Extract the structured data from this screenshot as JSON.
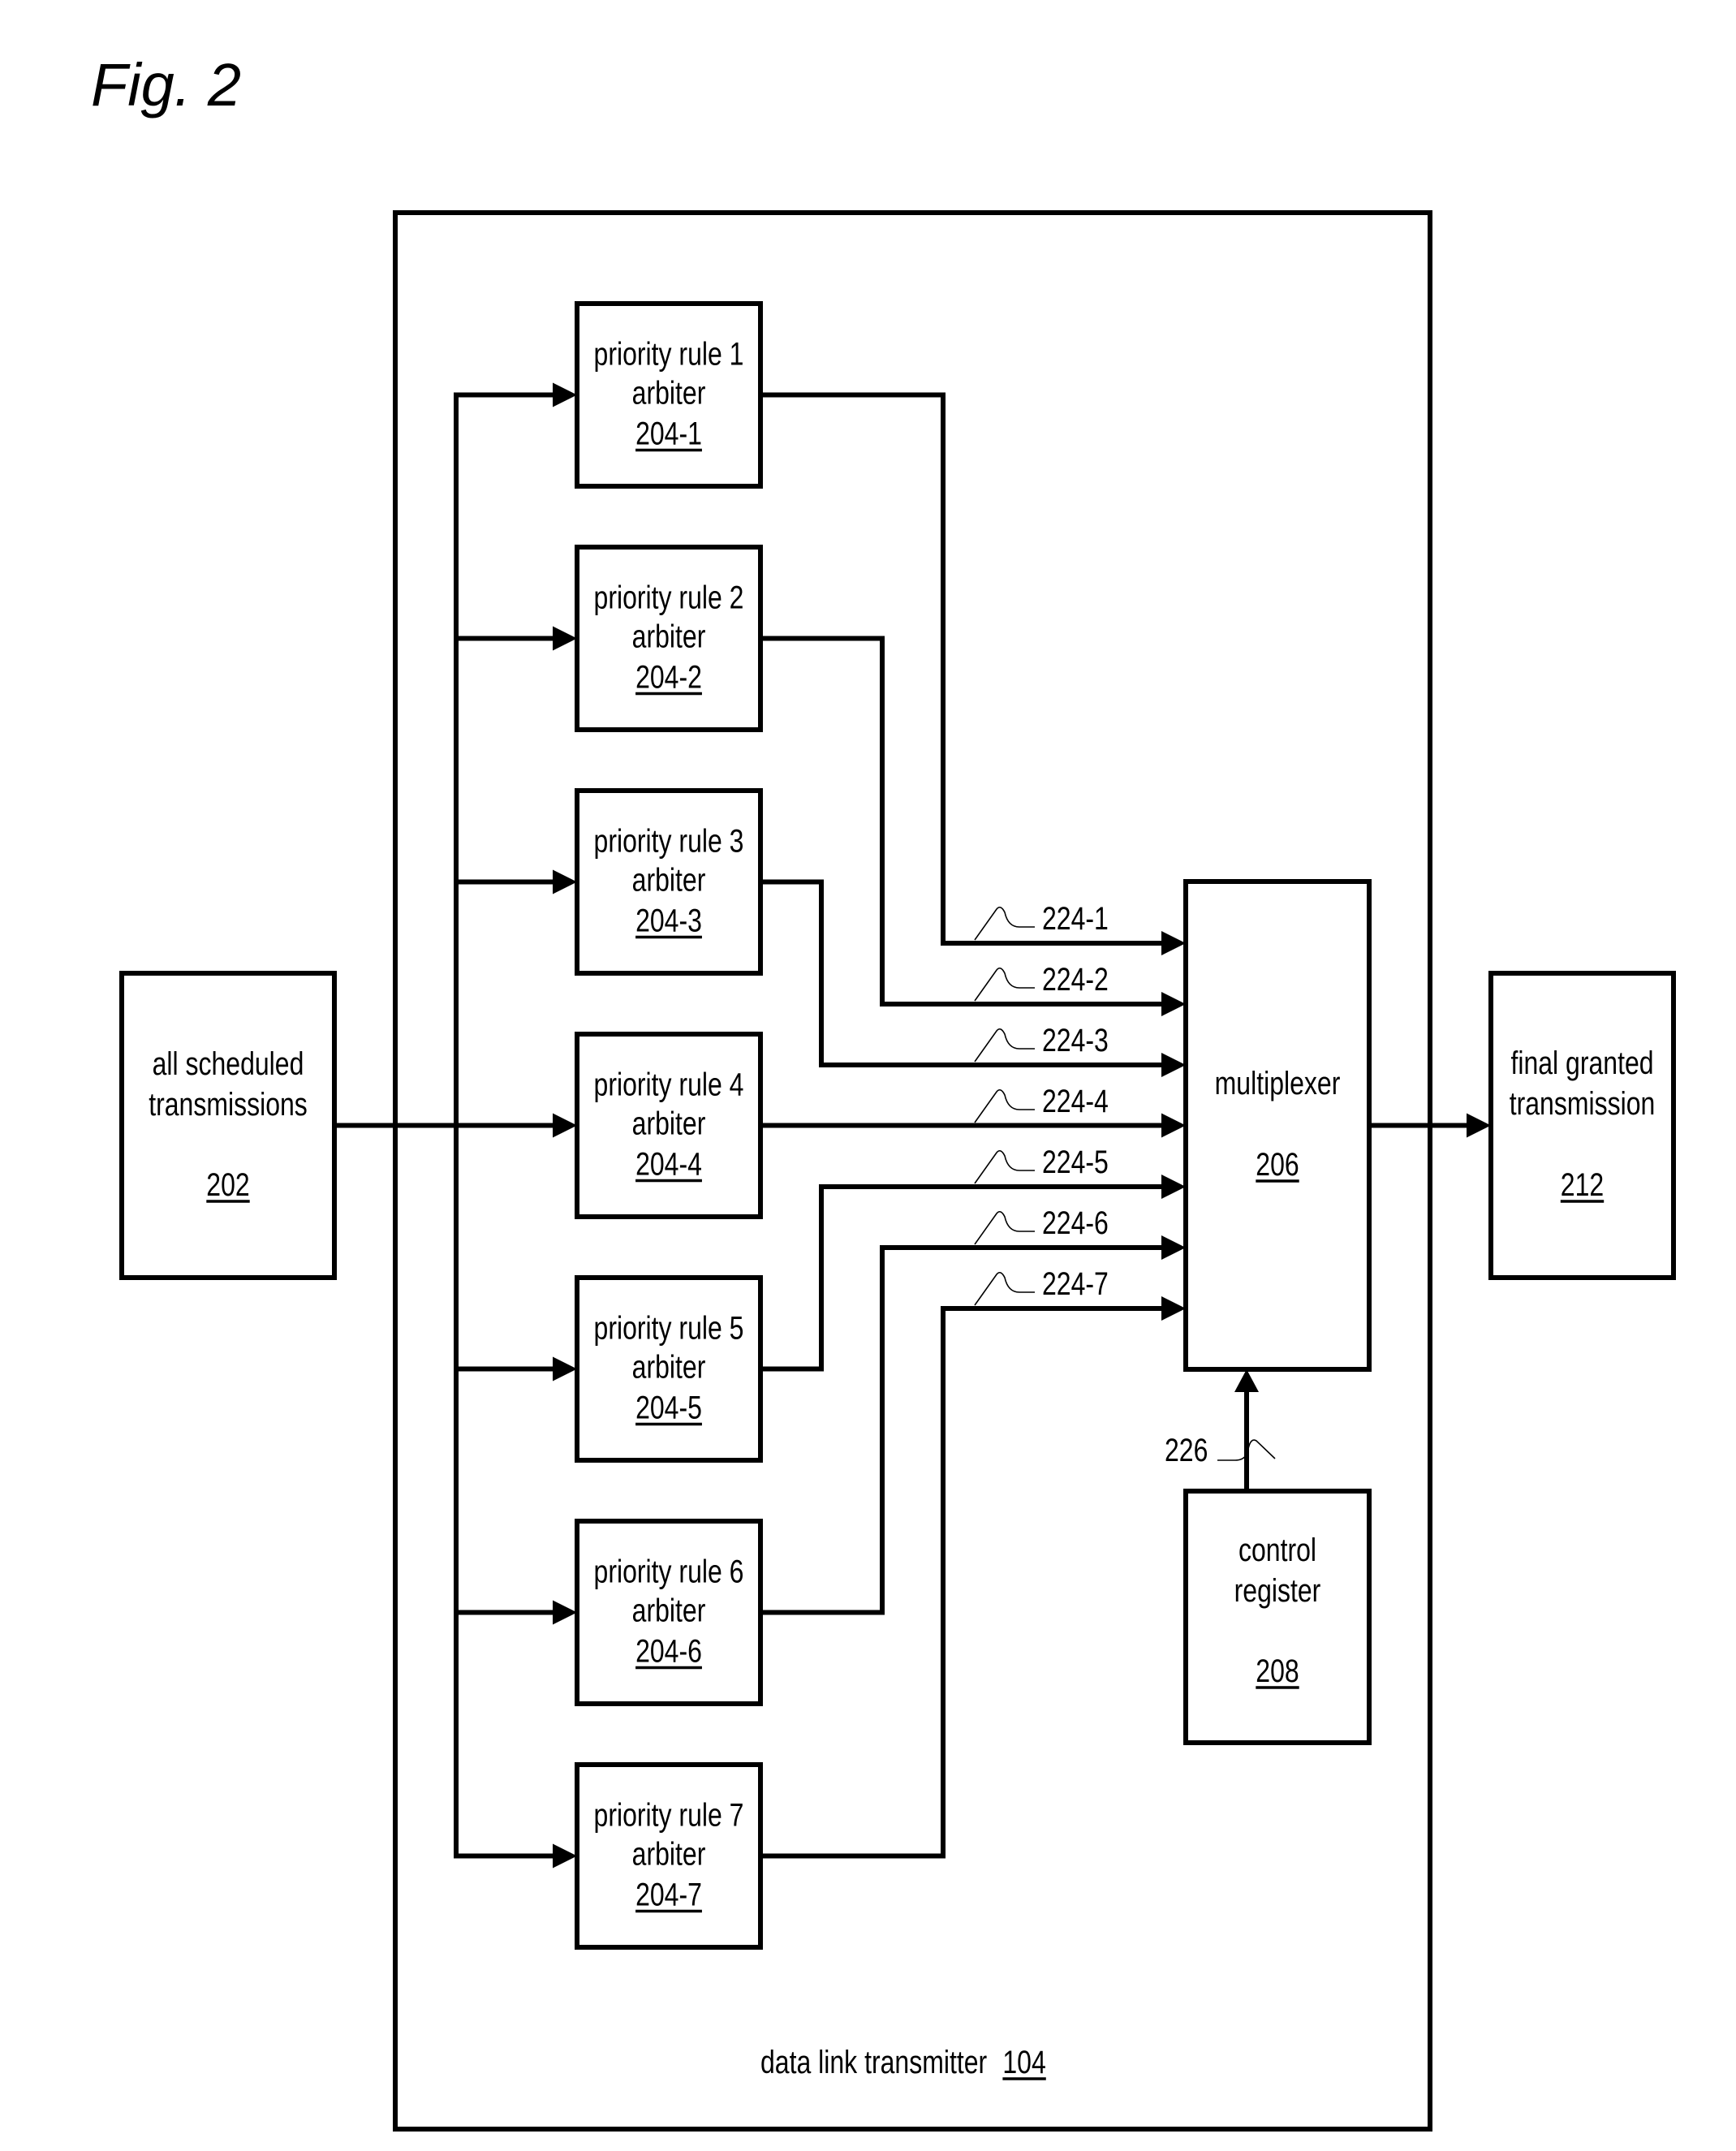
{
  "figure": {
    "title": "Fig. 2"
  },
  "container": {
    "label": "data link transmitter",
    "ref": "104"
  },
  "input_block": {
    "lines": [
      "all scheduled",
      "transmissions"
    ],
    "ref": "202"
  },
  "arbiters": [
    {
      "lines": [
        "priority rule 1",
        "arbiter"
      ],
      "ref": "204-1",
      "signal": "224-1"
    },
    {
      "lines": [
        "priority rule 2",
        "arbiter"
      ],
      "ref": "204-2",
      "signal": "224-2"
    },
    {
      "lines": [
        "priority rule 3",
        "arbiter"
      ],
      "ref": "204-3",
      "signal": "224-3"
    },
    {
      "lines": [
        "priority rule 4",
        "arbiter"
      ],
      "ref": "204-4",
      "signal": "224-4"
    },
    {
      "lines": [
        "priority rule 5",
        "arbiter"
      ],
      "ref": "204-5",
      "signal": "224-5"
    },
    {
      "lines": [
        "priority rule 6",
        "arbiter"
      ],
      "ref": "204-6",
      "signal": "224-6"
    },
    {
      "lines": [
        "priority rule 7",
        "arbiter"
      ],
      "ref": "204-7",
      "signal": "224-7"
    }
  ],
  "multiplexer": {
    "lines": [
      "multiplexer"
    ],
    "ref": "206"
  },
  "control_register": {
    "lines": [
      "control",
      "register"
    ],
    "ref": "208",
    "signal": "226"
  },
  "output_block": {
    "lines": [
      "final granted",
      "transmission"
    ],
    "ref": "212"
  },
  "colors": {
    "ink": "#000000",
    "paper": "#ffffff"
  }
}
